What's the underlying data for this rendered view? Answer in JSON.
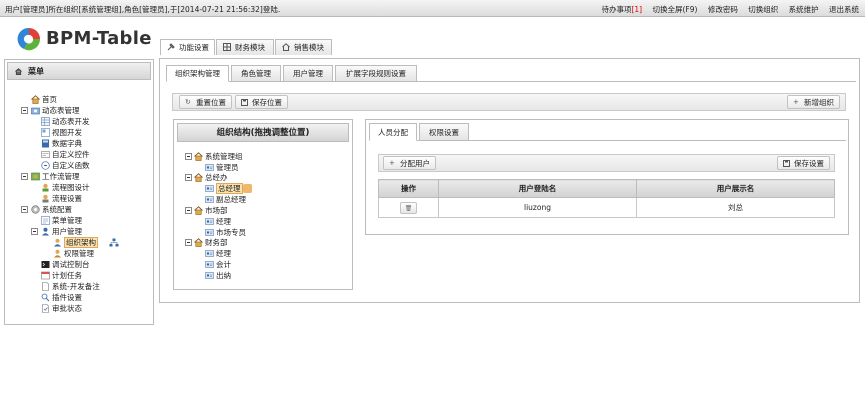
{
  "topbar": {
    "login_info": "用户[管理员]所在组织[系统管理组],角色[管理员],于[2014-07-21 21:56:32]登陆.",
    "todo_label": "待办事项",
    "todo_count": "[1]",
    "links": [
      "切换全屏(F9)",
      "修改密码",
      "切换组织",
      "系统维护",
      "退出系统"
    ]
  },
  "logo": {
    "text": "BPM-Table",
    "colors": [
      "#e0403a",
      "#2f86d6",
      "#5bb33a"
    ]
  },
  "module_tabs": [
    "功能设置",
    "财务模块",
    "销售模块"
  ],
  "sidebar": {
    "title": "菜单",
    "items": [
      {
        "label": "首页",
        "icon": "home-icon"
      },
      {
        "label": "动态表管理",
        "icon": "folder-icon"
      },
      {
        "label": "动态表开发",
        "icon": "table-icon"
      },
      {
        "label": "视图开发",
        "icon": "view-icon"
      },
      {
        "label": "数据字典",
        "icon": "book-icon"
      },
      {
        "label": "自定义控件",
        "icon": "control-icon"
      },
      {
        "label": "自定义函数",
        "icon": "function-icon"
      },
      {
        "label": "工作流管理",
        "icon": "workflow-icon"
      },
      {
        "label": "流程图设计",
        "icon": "flowchart-icon"
      },
      {
        "label": "流程设置",
        "icon": "flow-settings-icon"
      },
      {
        "label": "系统配置",
        "icon": "gear-icon"
      },
      {
        "label": "菜单管理",
        "icon": "menu-icon"
      },
      {
        "label": "用户管理",
        "icon": "user-icon"
      },
      {
        "label": "组织架构",
        "icon": "org-icon"
      },
      {
        "label": "权限管理",
        "icon": "permission-icon"
      },
      {
        "label": "调试控制台",
        "icon": "console-icon"
      },
      {
        "label": "计划任务",
        "icon": "task-icon"
      },
      {
        "label": "系统-开发备注",
        "icon": "note-icon"
      },
      {
        "label": "插件设置",
        "icon": "plugin-icon"
      },
      {
        "label": "审批状态",
        "icon": "status-icon"
      }
    ]
  },
  "sub_tabs": [
    "组织架构管理",
    "角色管理",
    "用户管理",
    "扩展字段规则设置"
  ],
  "toolbar": {
    "reset": "重置位置",
    "save": "保存位置",
    "add_org": "新增组织"
  },
  "org_panel": {
    "title": "组织结构(拖拽调整位置)",
    "nodes": [
      {
        "label": "系统管理组",
        "type": "group"
      },
      {
        "label": "管理员",
        "type": "role"
      },
      {
        "label": "总经办",
        "type": "group"
      },
      {
        "label": "总经理",
        "type": "role"
      },
      {
        "label": "副总经理",
        "type": "role"
      },
      {
        "label": "市场部",
        "type": "group"
      },
      {
        "label": "经理",
        "type": "role"
      },
      {
        "label": "市场专员",
        "type": "role"
      },
      {
        "label": "财务部",
        "type": "group"
      },
      {
        "label": "经理",
        "type": "role"
      },
      {
        "label": "会计",
        "type": "role"
      },
      {
        "label": "出纳",
        "type": "role"
      }
    ]
  },
  "right_tabs": [
    "人员分配",
    "权限设置"
  ],
  "user_toolbar": {
    "assign": "分配用户",
    "save": "保存设置"
  },
  "user_table": {
    "headers": [
      "操作",
      "用户登陆名",
      "用户展示名"
    ],
    "rows": [
      {
        "login": "liuzong",
        "display": "刘总"
      }
    ]
  }
}
